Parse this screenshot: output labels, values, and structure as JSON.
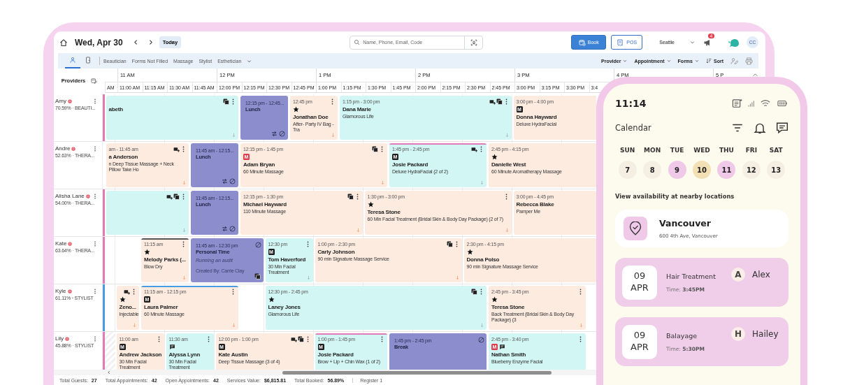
{
  "header": {
    "date": "Wed, Apr 30",
    "today": "Today",
    "search": {
      "placeholder": "Name, Phone, Email, Code"
    },
    "book": "Book",
    "pos": "POS",
    "location": "Seattle",
    "notifications": "4",
    "user": "CC"
  },
  "toolbar": {
    "views": [
      {
        "kind": "providers",
        "selected": true
      },
      {
        "kind": "rooms",
        "selected": false
      }
    ],
    "filters": [
      "Beautician",
      "Forms Not Filled",
      "Massage",
      "Stylist",
      "Esthetician"
    ],
    "menus": [
      {
        "label": "Provider",
        "kind": "dropdown"
      },
      {
        "label": "Appointment",
        "kind": "dropdown"
      },
      {
        "label": "Forms",
        "kind": "dropdown"
      },
      {
        "label": "Sort",
        "kind": "sort"
      }
    ]
  },
  "grid": {
    "providers_label": "Providers",
    "hours": [
      "11 AM",
      "12 PM",
      "1 PM",
      "2 PM",
      "3 PM",
      "4 PM",
      "5 P"
    ],
    "slots": [
      "AM",
      "11:00 AM",
      "11:15 AM",
      "11:30 AM",
      "11:45 AM",
      "12:00 PM",
      "12:15 PM",
      "12:30 PM",
      "12:45 PM",
      "1:00 PM",
      "1:15 PM",
      "1:30 PM",
      "1:45 PM",
      "2:00 PM",
      "2:15 PM",
      "2:30 PM",
      "2:45 PM",
      "3:00 PM",
      "3:15 PM",
      "3:30 PM",
      "3:4"
    ],
    "rows": [
      {
        "name": "Amy",
        "utilization": "70.59%",
        "role": "BEAUTI...",
        "color": "#e07bb5",
        "off_hours": false,
        "appointments": [
          {
            "color": "#d2f6f4",
            "name": "abeth",
            "actions": [
              {
                "kind": "copy"
              },
              {
                "kind": "menu"
              }
            ],
            "arrow": true
          },
          {
            "color": "#8b8dcd",
            "time": "12:15 pm - 12:45...",
            "name": "Lunch",
            "bottom": [
              {
                "kind": "swap"
              },
              {
                "kind": "blocked"
              }
            ]
          },
          {
            "color": "#fdebe0",
            "time": "12:45 pm",
            "markers": [
              {
                "kind": "star"
              }
            ],
            "name": "Jonathan Doe",
            "service": "After- Party IV Bag - Tra",
            "actions": [
              {
                "kind": "menu"
              }
            ],
            "arrow": true
          },
          {
            "color": "#d2f6f4",
            "time": "1:15 pm - 3:00 pm",
            "name": "Dana Marie",
            "service": "Glamorous Life",
            "actions": [
              {
                "kind": "add"
              },
              {
                "kind": "copy"
              },
              {
                "kind": "menu"
              }
            ],
            "arrow": true
          },
          {
            "color": "#fdebe0",
            "time": "3:00 pm - 4:00 pm",
            "markers": [
              {
                "kind": "badge",
                "label": "M",
                "color": "#1e1e1e"
              }
            ],
            "name": "Donna Hayward",
            "service": "Deluxe HydraFacial"
          }
        ]
      },
      {
        "name": "Andre",
        "utilization": "52.63%",
        "role": "THERA...",
        "off_hours": false,
        "appointments": [
          {
            "color": "#fdebe0",
            "time": "am - 11:45 am",
            "name": "a Anderson",
            "service": "n Deep Tissue Massage + Neck Pillow Take Ho",
            "actions": [
              {
                "kind": "add"
              },
              {
                "kind": "menu"
              }
            ],
            "arrow": true
          },
          {
            "color": "#8b8dcd",
            "time": "11:45 am - 12:15...",
            "name": "Lunch",
            "bottom": [
              {
                "kind": "swap"
              },
              {
                "kind": "blocked"
              }
            ]
          },
          {
            "color": "#fdebe0",
            "time": "12:15 pm - 1:45 pm",
            "markers": [
              {
                "kind": "badge",
                "label": "M",
                "color": "#e23b4b"
              }
            ],
            "name": "Adam Bryan",
            "service": "60 Minute Massage",
            "actions": [
              {
                "kind": "copy"
              },
              {
                "kind": "menu"
              }
            ],
            "arrow": true
          },
          {
            "color": "#d2f6f4",
            "accent": {
              "color": "#e07bb5"
            },
            "time": "1:45 pm - 2:45 pm",
            "markers": [
              {
                "kind": "badge",
                "label": "M",
                "color": "#1e1e1e"
              }
            ],
            "name": "Josie Packard",
            "service": "Deluxe HydraFacial (2 of 2)",
            "actions": [
              {
                "kind": "add"
              },
              {
                "kind": "menu"
              }
            ],
            "arrow": true
          },
          {
            "color": "#fdebe0",
            "time": "2:45 pm - 4:15 pm",
            "markers": [
              {
                "kind": "star"
              }
            ],
            "name": "Danielle West",
            "service": "60 Minute Aromatherapy Massage"
          }
        ]
      },
      {
        "name": "Alisha Lane",
        "utilization": "54.00%",
        "role": "THERA...",
        "color": "#e07bb5",
        "off_hours": false,
        "appointments": [
          {
            "color": "#d2f6f4",
            "actions": [
              {
                "kind": "add"
              },
              {
                "kind": "copy"
              },
              {
                "kind": "menu"
              }
            ],
            "arrow": true
          },
          {
            "color": "#8b8dcd",
            "time": "11:45 am - 12:15...",
            "name": "Lunch",
            "bottom": [
              {
                "kind": "swap"
              },
              {
                "kind": "blocked"
              }
            ]
          },
          {
            "color": "#fdebe0",
            "time": "12:15 pm - 1:30 pm",
            "name": "Michael Hayward",
            "service": "110 Minute Massage",
            "actions": [
              {
                "kind": "copy"
              },
              {
                "kind": "menu"
              }
            ],
            "arrow": true
          },
          {
            "color": "#fdebe0",
            "time": "1:30 pm - 3:00 pm",
            "markers": [
              {
                "kind": "star"
              }
            ],
            "name": "Teresa Stone",
            "service": "60 Min Facial Treatment (Bridal Skin & Body Day Package) (2 of 7)",
            "actions": [
              {
                "kind": "menu"
              }
            ],
            "arrow": true
          },
          {
            "color": "#fdebe0",
            "time": "3:00 pm - 4:45 pm",
            "name": "Rebecca Blake",
            "service": "Pamper Me"
          }
        ]
      },
      {
        "name": "Kate",
        "utilization": "63.64%",
        "role": "THERA...",
        "color": "#e07bb5",
        "off_hours": false,
        "appointments": [
          {
            "color": "#fdebe0",
            "accent": {
              "color": "#555555"
            },
            "time": "11:15 am",
            "markers": [
              {
                "kind": "star"
              }
            ],
            "name": "Melody Parks (...",
            "service": "Blow Dry",
            "actions": [
              {
                "kind": "menu"
              }
            ],
            "arrow": true
          },
          {
            "color": "#8b8dcd",
            "time": "11:45 am - 12:30 pm",
            "name": "Personal Time",
            "note": "Running an audit",
            "created": "Created By: Carrie Clay",
            "actions": [
              {
                "kind": "blocked"
              }
            ],
            "bottom": [
              {
                "kind": "copy"
              }
            ]
          },
          {
            "color": "#d2f6f4",
            "time": "12:30 pm",
            "markers": [
              {
                "kind": "badge",
                "label": "M",
                "color": "#1e1e1e"
              }
            ],
            "name": "Tom Haverford",
            "service": "30 Min Facial Treatment",
            "actions": [
              {
                "kind": "menu"
              }
            ],
            "arrow": true
          },
          {
            "color": "#fdebe0",
            "time": "1:00 pm - 2:30 pm",
            "name": "Carly Johnson",
            "service": "90 min Signature Massage Service",
            "actions": [
              {
                "kind": "copy"
              },
              {
                "kind": "menu"
              }
            ],
            "arrow": true
          },
          {
            "color": "#fdebe0",
            "time": "2:30 pm - 4:15 pm",
            "markers": [
              {
                "kind": "star"
              }
            ],
            "name": "Donna Polso",
            "service": "90 min Signature Massage Service"
          }
        ]
      },
      {
        "name": "Kyle",
        "utilization": "61.11%",
        "role": "STYLIST",
        "color": "#4a9be0",
        "off_hours": false,
        "appointments": [
          {
            "color": "#fdebe0",
            "markers": [
              {
                "kind": "star"
              }
            ],
            "name": "Zeno...",
            "service": "Injectable",
            "actions": [
              {
                "kind": "add"
              },
              {
                "kind": "menu"
              }
            ],
            "arrow": true
          },
          {
            "color": "#fdebe0",
            "accent": {
              "color": "#4a9be0"
            },
            "time": "11:15 am - 12:15 pm",
            "markers": [
              {
                "kind": "badge",
                "label": "M",
                "color": "#1e1e1e"
              }
            ],
            "name": "Laura Palmer",
            "service": "60 Minute Massage",
            "actions": [
              {
                "kind": "menu"
              }
            ],
            "arrow": true
          },
          {
            "color": "#d2f6f4",
            "time": "12:30 pm - 2:45 pm",
            "markers": [
              {
                "kind": "star"
              }
            ],
            "name": "Laney Jones",
            "service": "Glamorous Life",
            "actions": [
              {
                "kind": "copy"
              },
              {
                "kind": "menu"
              }
            ],
            "arrow": true
          },
          {
            "color": "#fdebe0",
            "time": "2:45 pm - 3:45 pm",
            "markers": [
              {
                "kind": "star"
              }
            ],
            "name": "Teresa Stone",
            "service": "Back Treatment (Bridal Skin & Body Day Package) (3",
            "actions": [
              {
                "kind": "menu"
              }
            ],
            "arrow": true
          }
        ]
      },
      {
        "name": "Lily",
        "utilization": "45.88%",
        "role": "STYLIST",
        "color": "#e07bb5",
        "off_hours": true,
        "appointments": [
          {
            "color": "#fdebe0",
            "time": "11:00 am",
            "markers": [
              {
                "kind": "badge",
                "label": "M",
                "color": "#1e1e1e"
              }
            ],
            "name": "Andrew Jackson",
            "service": "30 Min Facial Treatment",
            "actions": [
              {
                "kind": "menu"
              }
            ]
          },
          {
            "color": "#d2f6f4",
            "time": "11:30 am",
            "markers": [
              {
                "kind": "chat"
              }
            ],
            "name": "Alyssa Lynn",
            "service": "30 Min Facial Treatment",
            "actions": [
              {
                "kind": "menu"
              }
            ]
          },
          {
            "color": "#fdebe0",
            "time": "12:00 pm - 1:00 pm",
            "markers": [
              {
                "kind": "badge",
                "label": "M",
                "color": "#1e1e1e"
              }
            ],
            "name": "Kate Austin",
            "service": "Deep Tissue Massage (3 of 4)",
            "actions": [
              {
                "kind": "add"
              },
              {
                "kind": "copy"
              },
              {
                "kind": "menu"
              }
            ]
          },
          {
            "color": "#d2f6f4",
            "accent": {
              "color": "#e07bb5"
            },
            "time": "1:00 pm - 1:45 pm",
            "markers": [
              {
                "kind": "badge",
                "label": "M",
                "color": "#1e1e1e"
              }
            ],
            "name": "Josie Packard",
            "service": "Brow + Lip + Chin Wax (1 of 2)",
            "actions": [
              {
                "kind": "menu"
              }
            ]
          },
          {
            "color": "#8b8dcd",
            "time": "1:45 pm - 2:45 pm",
            "name": "Break",
            "actions": [
              {
                "kind": "blocked"
              }
            ]
          },
          {
            "color": "#d2f6f4",
            "time": "2:45 pm - 3:40 pm",
            "markers": [
              {
                "kind": "badge",
                "label": "M",
                "color": "#e23b4b"
              },
              {
                "kind": "chat"
              }
            ],
            "name": "Nathan Smith",
            "service": "Blueberry Enzyme Facial",
            "actions": [
              {
                "kind": "menu"
              }
            ]
          }
        ]
      }
    ]
  },
  "footer": {
    "stats": [
      {
        "label": "Total Guests:",
        "value": "27"
      },
      {
        "label": "Total Appointments:",
        "value": "42"
      },
      {
        "label": "Open Appointments:",
        "value": "42"
      },
      {
        "label": "Services Value:",
        "value": "$6,815.81"
      },
      {
        "label": "Total Booked:",
        "value": "56.89%"
      }
    ],
    "register": "Register 1"
  },
  "phone": {
    "time": "11:14",
    "title": "Calendar",
    "days": [
      {
        "weekday": "SUN",
        "date": "7",
        "selected": false,
        "marked": false
      },
      {
        "weekday": "MON",
        "date": "8",
        "selected": false,
        "marked": false
      },
      {
        "weekday": "TUE",
        "date": "9",
        "selected": false,
        "marked": true
      },
      {
        "weekday": "WED",
        "date": "10",
        "selected": true,
        "marked": false
      },
      {
        "weekday": "THU",
        "date": "11",
        "selected": false,
        "marked": true
      },
      {
        "weekday": "FRI",
        "date": "12",
        "selected": false,
        "marked": false
      },
      {
        "weekday": "SAT",
        "date": "13",
        "selected": false,
        "marked": false
      }
    ],
    "nearby": "View availability at nearby locations",
    "location": {
      "name": "Vancouver",
      "address": "600 4th Ave, Vancouver"
    },
    "bookings": [
      {
        "day": "09",
        "month": "APR",
        "service": "Hair Treatment",
        "time": "Time: **3:45PM**",
        "initial": "A",
        "client": "Alex"
      },
      {
        "day": "09",
        "month": "APR",
        "service": "Balayage",
        "time": "Time: **5:30PM**",
        "initial": "H",
        "client": "Hailey"
      }
    ]
  }
}
